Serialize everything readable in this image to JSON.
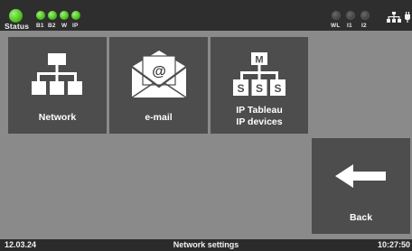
{
  "status_bar": {
    "status_label": "Status",
    "indicators_left": [
      "B1",
      "B2",
      "W",
      "IP"
    ],
    "indicators_right": [
      "WL",
      "I1",
      "I2"
    ],
    "network_icon": "network-tree-icon",
    "colors": {
      "led_on": "#4cc21d",
      "led_off": "#474747"
    }
  },
  "menu": {
    "network_label": "Network",
    "email_label": "e-mail",
    "email_symbol": "@",
    "ip_tableau_line1": "IP Tableau",
    "ip_tableau_line2": "IP devices",
    "ip_icon_master": "M",
    "ip_icon_slave": "S",
    "back_label": "Back"
  },
  "footer": {
    "date": "12.03.24",
    "title": "Network settings",
    "time": "10:27:50"
  }
}
